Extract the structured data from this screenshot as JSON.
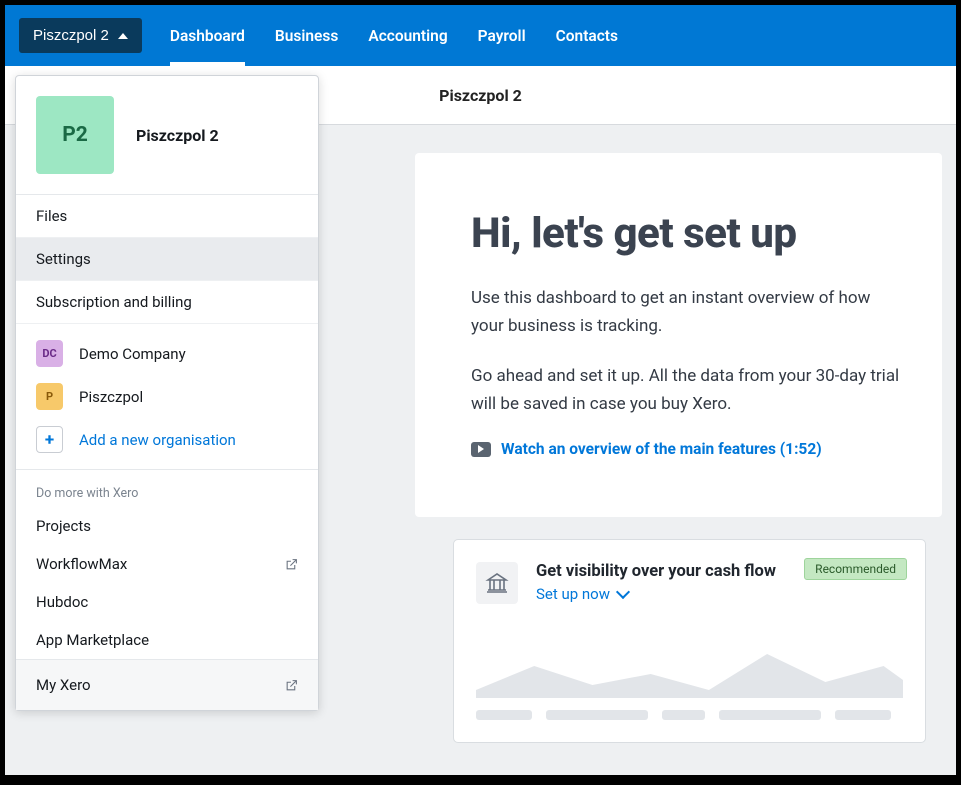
{
  "topbar": {
    "org_button_label": "Piszczpol 2",
    "nav": [
      "Dashboard",
      "Business",
      "Accounting",
      "Payroll",
      "Contacts"
    ]
  },
  "subheader": {
    "title": "Piszczpol 2"
  },
  "welcome": {
    "heading": "Hi, let's get set up",
    "p1": "Use this dashboard to get an instant overview of how your business is tracking.",
    "p2": "Go ahead and set it up. All the data from your 30-day trial will be saved in case you buy Xero.",
    "video_link": "Watch an overview of the main features (1:52)"
  },
  "cashflow": {
    "title": "Get visibility over your cash flow",
    "link": "Set up now",
    "badge": "Recommended"
  },
  "dropdown": {
    "avatar_initials": "P2",
    "org_name": "Piszczpol 2",
    "items": [
      "Files",
      "Settings",
      "Subscription and billing"
    ],
    "orgs": [
      {
        "initials": "DC",
        "name": "Demo Company",
        "cls": "dc"
      },
      {
        "initials": "P",
        "name": "Piszczpol",
        "cls": "p"
      }
    ],
    "add_new": "Add a new organisation",
    "section_label": "Do more with Xero",
    "more": [
      "Projects",
      "WorkflowMax",
      "Hubdoc",
      "App Marketplace"
    ],
    "footer": "My Xero"
  }
}
